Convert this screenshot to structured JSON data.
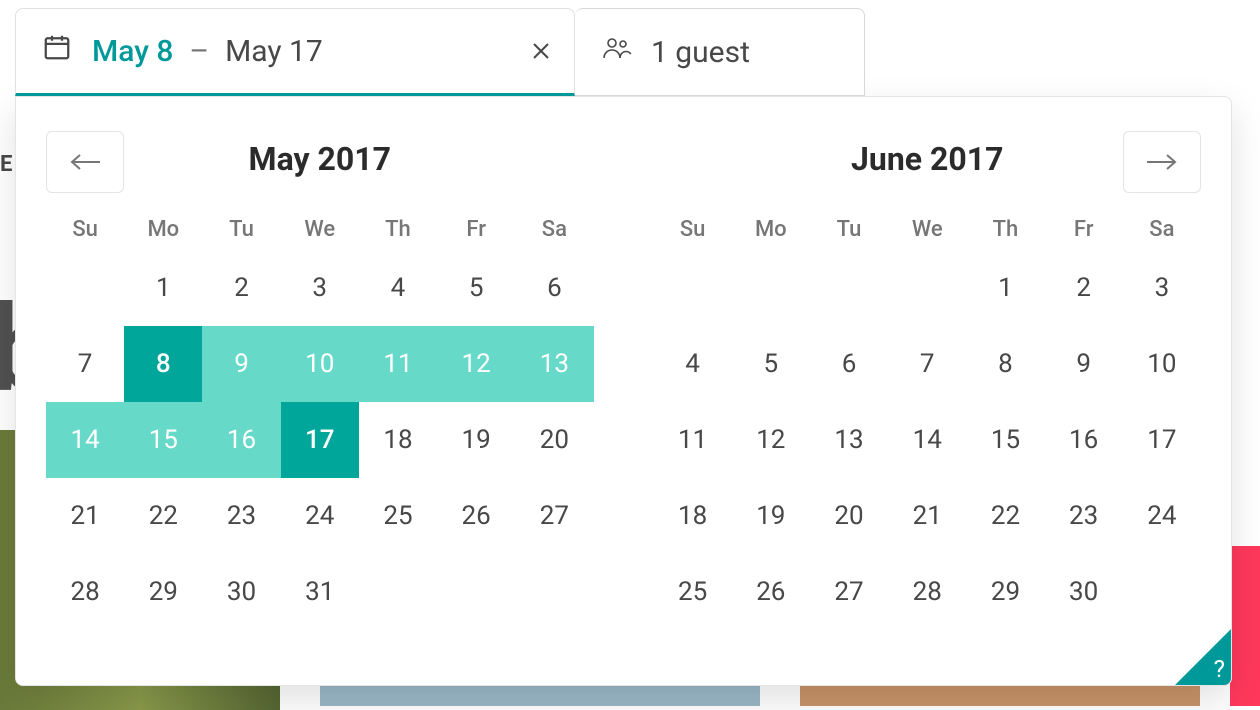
{
  "colors": {
    "accent": "#009999",
    "range": "#66d9c9",
    "endpoint": "#00a699",
    "text": "#484848",
    "muted": "#767676",
    "border": "#e4e4e4"
  },
  "header": {
    "dates_tab": {
      "start_label": "May 8",
      "separator": "–",
      "end_label": "May 17",
      "calendar_icon": "calendar-icon",
      "close_icon": "close-icon"
    },
    "guests_tab": {
      "label": "1 guest",
      "guests_icon": "guests-icon"
    }
  },
  "weekdays": [
    "Su",
    "Mo",
    "Tu",
    "We",
    "Th",
    "Fr",
    "Sa"
  ],
  "months": [
    {
      "title": "May 2017",
      "lead_blank": 1,
      "days_in_month": 31,
      "range": {
        "start": 8,
        "end": 17
      }
    },
    {
      "title": "June 2017",
      "lead_blank": 4,
      "days_in_month": 30,
      "range": null
    }
  ],
  "nav": {
    "prev_icon": "arrow-left-icon",
    "next_icon": "arrow-right-icon"
  },
  "help": {
    "label": "?"
  },
  "edge_hint": "E"
}
